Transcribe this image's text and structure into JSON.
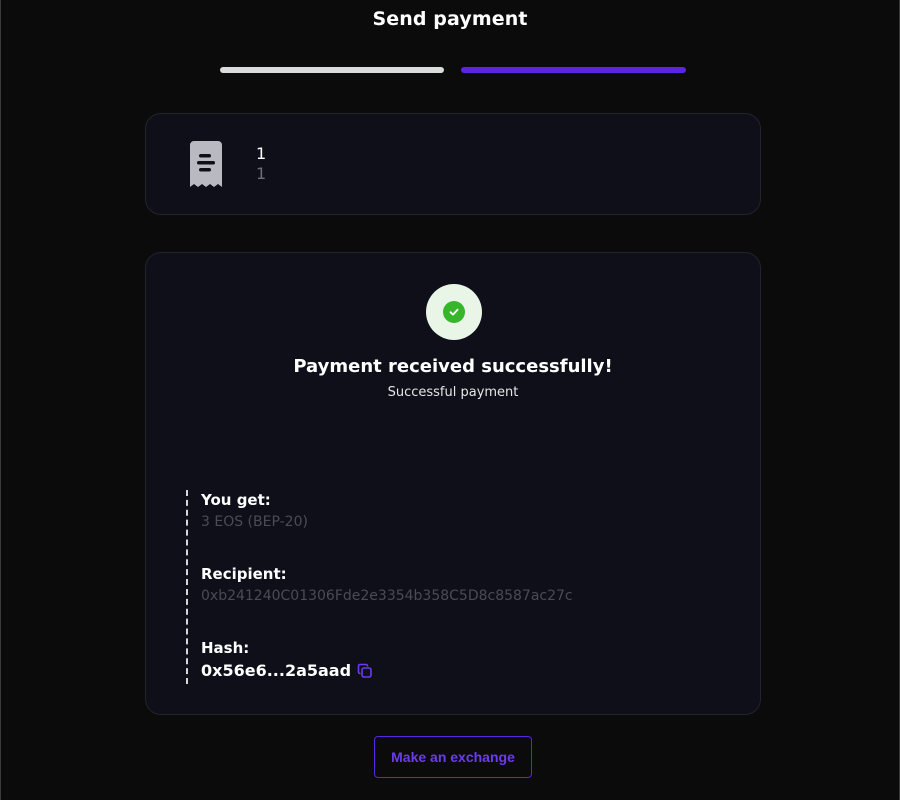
{
  "header": {
    "title": "Send payment"
  },
  "progress": {
    "total_steps": 2,
    "current_step": 2
  },
  "order": {
    "icon": "receipt-icon",
    "primary": "1",
    "secondary": "1"
  },
  "status": {
    "icon": "check-circle-icon",
    "headline": "Payment received successfully!",
    "subline": "Successful payment"
  },
  "details": {
    "you_get_label": "You get:",
    "you_get_value": "3 EOS (BEP-20)",
    "recipient_label": "Recipient:",
    "recipient_value": "0xb241240C01306Fde2e3354b358C5D8c8587ac27c",
    "hash_label": "Hash:",
    "hash_value": "0x56e6...2a5aad",
    "copy_icon": "copy-icon"
  },
  "actions": {
    "exchange_label": "Make an exchange"
  },
  "colors": {
    "accent": "#5b24e6",
    "success": "#37b52b",
    "background": "#0b0b0b",
    "card": "#0f0f1a"
  }
}
